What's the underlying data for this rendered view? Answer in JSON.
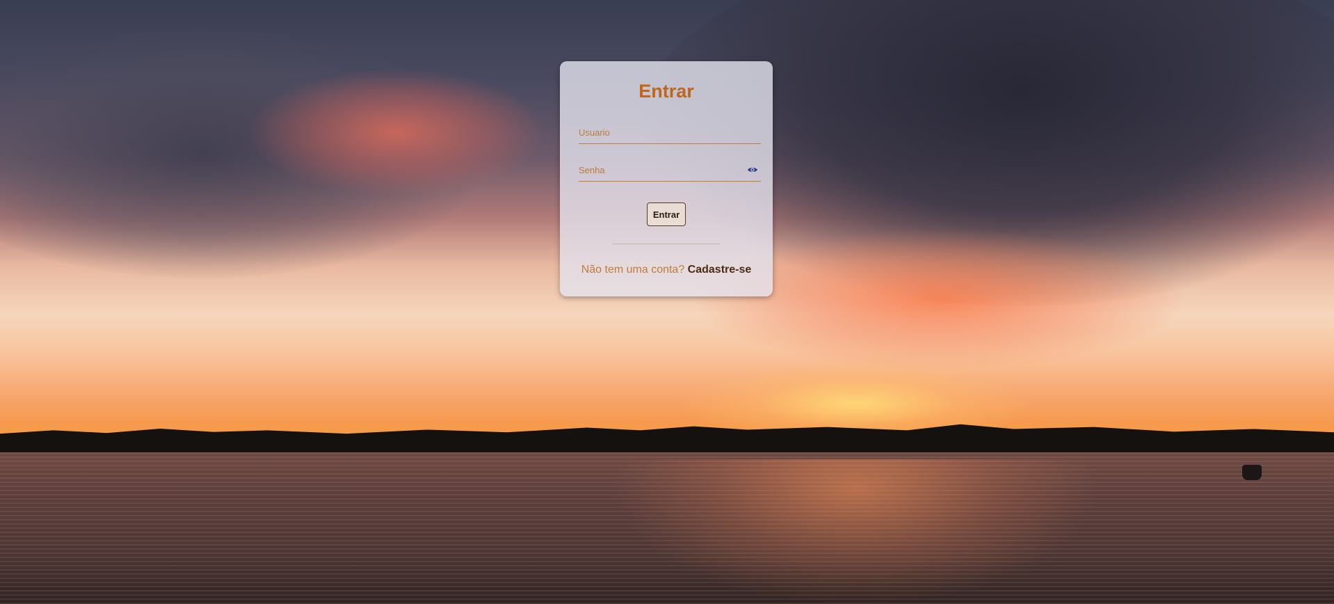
{
  "login": {
    "title": "Entrar",
    "username_placeholder": "Usuario",
    "password_placeholder": "Senha",
    "submit_label": "Entrar",
    "signup_prompt": "Não tem uma conta?",
    "signup_link": "Cadastre-se"
  },
  "icons": {
    "password_toggle": "eye-icon"
  },
  "colors": {
    "accent": "#c0651a",
    "link": "#4a2b12",
    "field_underline": "#c77a32",
    "icon": "#2c3a8c"
  }
}
